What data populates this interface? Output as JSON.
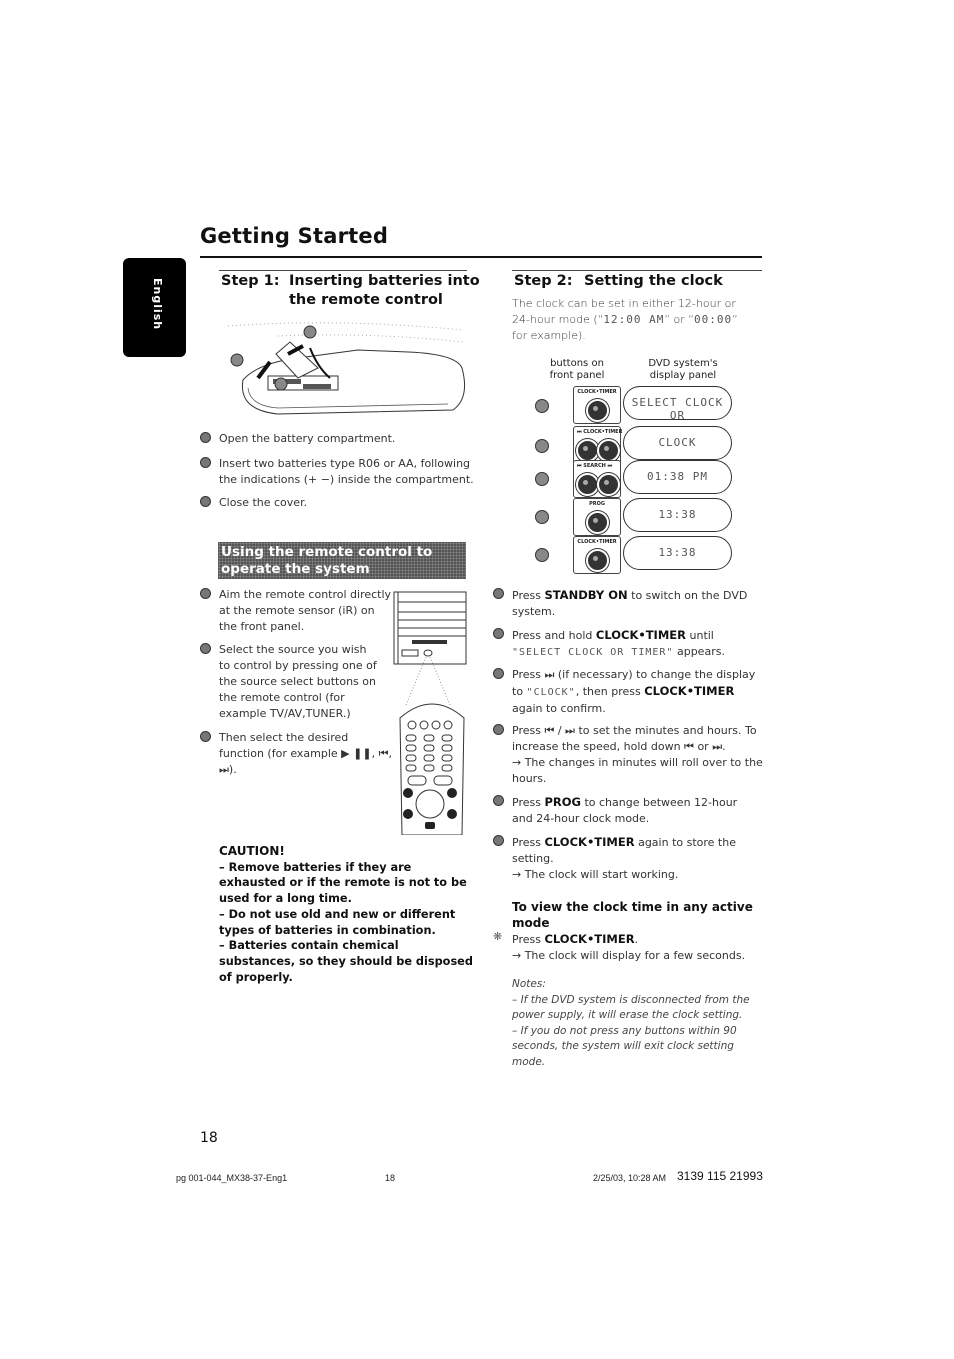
{
  "header": {
    "title": "Getting Started",
    "language_tab": "English"
  },
  "step1": {
    "number": "Step 1:",
    "title_line1": "Inserting batteries into",
    "title_line2": "the remote control",
    "illustration": "remote-battery-compartment-illustration",
    "instructions": [
      {
        "num": "1",
        "text": "Open the battery compartment."
      },
      {
        "num": "2",
        "text": "Insert two batteries type R06 or AA, following the indications (+ −) inside the compartment."
      },
      {
        "num": "3",
        "text": "Close the cover."
      }
    ]
  },
  "remote_section": {
    "banner": "Using the remote control to operate the system",
    "instructions": [
      {
        "num": "1",
        "text": "Aim the remote control directly at the remote sensor (iR) on the front panel."
      },
      {
        "num": "2",
        "text": "Select the source you wish to control by pressing one of the source select buttons on the remote control (for example TV/AV,TUNER.)"
      },
      {
        "num": "3",
        "text": "Then select the desired function (for example ▶ ❚❚, ⏮, ⏭)."
      }
    ]
  },
  "caution": {
    "title": "CAUTION!",
    "items": [
      "–  Remove batteries if they are exhausted or if the remote is not to be used for a long time.",
      "–  Do not use old and new or different types of batteries in combination.",
      "–  Batteries contain chemical substances, so they should be disposed of properly."
    ]
  },
  "step2": {
    "number": "Step 2:",
    "title": "Setting the clock",
    "intro_a": "The clock can be set in either 12-hour or 24-hour mode (“",
    "intro_lcd1": "12:00 AM",
    "intro_b": "” or “",
    "intro_lcd2": "00:00",
    "intro_c": "” for example).",
    "diagram": {
      "col_buttons": "buttons on front panel",
      "col_display": "DVD system's display panel",
      "rows": [
        {
          "step": "2",
          "buttons": [
            "CLOCK•TIMER"
          ],
          "display": "SELECT CLOCK OR"
        },
        {
          "step": "3",
          "buttons": [
            "⏭",
            "CLOCK•TIMER"
          ],
          "display": "CLOCK"
        },
        {
          "step": "4",
          "buttons": [
            "⏮ SEARCH",
            "⏭"
          ],
          "display": "01:38 PM"
        },
        {
          "step": "5",
          "buttons": [
            "PROG"
          ],
          "display": "13:38"
        },
        {
          "step": "6",
          "buttons": [
            "CLOCK•TIMER"
          ],
          "display": "13:38"
        }
      ]
    },
    "instructions": [
      {
        "num": "1",
        "pre": "Press ",
        "key": "STANDBY ON",
        "post": " to switch on the DVD system."
      },
      {
        "num": "2",
        "pre": "Press and hold ",
        "key": "CLOCK•TIMER",
        "post": " until",
        "lcd": "\"SELECT CLOCK OR TIMER\"",
        "post2": " appears."
      },
      {
        "num": "3",
        "pre": "Press ⏭ (if necessary) to change the display to ",
        "lcd": "\"CLOCK\"",
        "post": ", then press ",
        "key": "CLOCK•TIMER",
        "post2": " again to confirm."
      },
      {
        "num": "4",
        "text": "Press ⏮ / ⏭ to set the minutes and hours. To increase the speed, hold down ⏮ or ⏭.",
        "result": "→ The changes in minutes will roll over to the hours."
      },
      {
        "num": "5",
        "pre": "Press ",
        "key": "PROG",
        "post": " to change between 12-hour and 24-hour clock mode."
      },
      {
        "num": "6",
        "pre": "Press ",
        "key": "CLOCK•TIMER",
        "post": " again to store the setting.",
        "result": "→ The clock will start working."
      }
    ],
    "view_clock": {
      "heading": "To view the clock time in any active mode",
      "pre": "Press ",
      "key": "CLOCK•TIMER",
      "post": ".",
      "result": "→ The clock will display for a few seconds."
    },
    "notes": {
      "title": "Notes:",
      "items": [
        "–  If the DVD system is disconnected from the power supply, it will erase the clock setting.",
        "–  If you do not press any buttons within 90 seconds, the system will exit clock setting mode."
      ]
    }
  },
  "footer": {
    "page_number": "18",
    "file": "pg 001-044_MX38-37-Eng1",
    "mid_page": "18",
    "datetime": "2/25/03, 10:28 AM",
    "code": "3139 115 21993"
  }
}
